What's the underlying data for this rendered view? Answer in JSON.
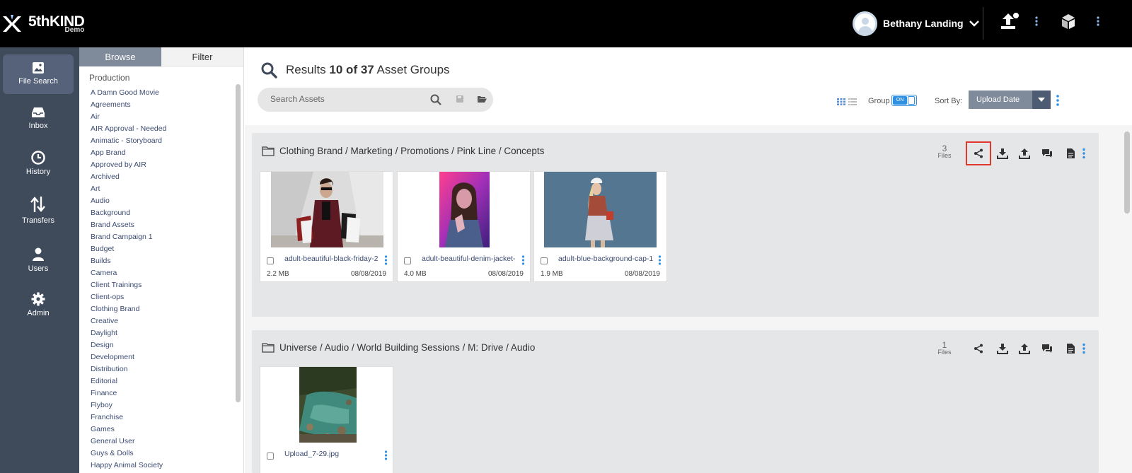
{
  "app": {
    "brand": "5thKIND",
    "brand_sub": "Demo",
    "user_name": "Bethany Landing"
  },
  "nav": [
    {
      "label": "File Search",
      "icon": "image-icon",
      "active": true
    },
    {
      "label": "Inbox",
      "icon": "inbox-icon"
    },
    {
      "label": "History",
      "icon": "clock-icon"
    },
    {
      "label": "Transfers",
      "icon": "transfer-arrows-icon"
    },
    {
      "label": "Users",
      "icon": "user-icon"
    },
    {
      "label": "Admin",
      "icon": "gear-icon"
    }
  ],
  "browse": {
    "tab_browse": "Browse",
    "tab_filter": "Filter",
    "heading": "Production",
    "items": [
      "A Damn Good Movie",
      "Agreements",
      "Air",
      "AIR Approval - Needed",
      "Animatic - Storyboard",
      "App Brand",
      "Approved by AIR",
      "Archived",
      "Art",
      "Audio",
      "Background",
      "Brand Assets",
      "Brand Campaign 1",
      "Budget",
      "Builds",
      "Camera",
      "Client Trainings",
      "Client-ops",
      "Clothing Brand",
      "Creative",
      "Daylight",
      "Design",
      "Development",
      "Distribution",
      "Editorial",
      "Finance",
      "Flyboy",
      "Franchise",
      "Games",
      "General User",
      "Guys & Dolls",
      "Happy Animal Society"
    ]
  },
  "results": {
    "prefix": "Results",
    "count": "10 of 37",
    "suffix": "Asset Groups"
  },
  "search": {
    "placeholder": "Search Assets"
  },
  "toolbar": {
    "group_label": "Group",
    "toggle_label": "ON",
    "sort_label": "Sort By:",
    "sort_value": "Upload Date"
  },
  "groups": [
    {
      "path": "Clothing Brand / Marketing / Promotions / Pink Line / Concepts",
      "files_count": "3",
      "files_label": "Files",
      "assets": [
        {
          "name": "adult-beautiful-black-friday-2",
          "size": "2.2 MB",
          "date": "08/08/2019"
        },
        {
          "name": "adult-beautiful-denim-jacket-",
          "size": "4.0 MB",
          "date": "08/08/2019"
        },
        {
          "name": "adult-blue-background-cap-1",
          "size": "1.9 MB",
          "date": "08/08/2019"
        }
      ]
    },
    {
      "path": "Universe / Audio / World Building Sessions / M: Drive / Audio",
      "files_count": "1",
      "files_label": "Files",
      "assets": [
        {
          "name": "Upload_7-29.jpg"
        }
      ]
    }
  ],
  "colors": {
    "topbar": "#000000",
    "nav_bg": "#3f4a5b",
    "accent_blue": "#2f8fe3",
    "highlight_red": "#e0382d",
    "sort_button": "#7f8a9a"
  }
}
